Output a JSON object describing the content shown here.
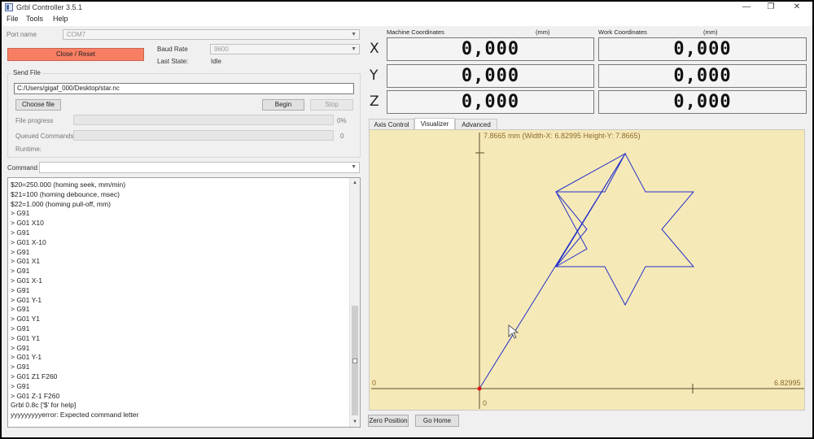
{
  "window": {
    "title": "Grbl Controller 3.5.1",
    "minimize": "—",
    "restore": "❐",
    "close": "✕"
  },
  "menu": [
    "File",
    "Tools",
    "Help"
  ],
  "connection": {
    "port_label": "Port name",
    "port_value": "COM7",
    "close_reset_label": "Close / Reset",
    "baud_label": "Baud Rate",
    "baud_value": "9600",
    "last_state_label": "Last State:",
    "last_state_value": "Idle"
  },
  "send_file": {
    "group_label": "Send File",
    "path": "C:/Users/gigaf_000/Desktop/star.nc",
    "choose_label": "Choose file",
    "begin_label": "Begin",
    "stop_label": "Stop",
    "progress_label": "File progress",
    "progress_value": "0%",
    "progress_fraction": 0,
    "queued_label": "Queued Commands",
    "queued_value": "0",
    "runtime_label": "Runtime:"
  },
  "command": {
    "label": "Command",
    "value": ""
  },
  "console_lines": [
    "$20=250.000 (homing seek, mm/min)",
    "$21=100 (homing debounce, msec)",
    "$22=1.000 (homing pull-off, mm)",
    "> G91",
    "> G01 X10",
    "> G91",
    "> G01 X-10",
    "> G91",
    "> G01 X1",
    "> G91",
    "> G01 X-1",
    "> G91",
    "> G01 Y-1",
    "> G91",
    "> G01 Y1",
    "> G91",
    "> G01 Y1",
    "> G91",
    "> G01 Y-1",
    "> G91",
    "> G01 Z1 F260",
    "> G91",
    "> G01 Z-1 F260",
    "Grbl 0.8c ['$' for help]",
    "yyyyyyyyyerror: Expected command letter"
  ],
  "coordinates": {
    "machine_label": "Machine Coordinates",
    "work_label": "Work Coordinates",
    "unit": "(mm)",
    "axes": [
      "X",
      "Y",
      "Z"
    ],
    "machine": [
      "0,000",
      "0,000",
      "0,000"
    ],
    "work": [
      "0,000",
      "0,000",
      "0,000"
    ]
  },
  "tabs": [
    "Axis Control",
    "Visualizer",
    "Advanced"
  ],
  "active_tab": "Visualizer",
  "visualizer": {
    "header": "7.8665 mm  (Width-X: 6.82995  Height-Y: 7.8665)",
    "x_min_label": "0",
    "x_max_label": "6.82995",
    "y_min_label": "0",
    "width_x": 6.82995,
    "height_y": 7.8665,
    "colors": {
      "background": "#f6e9b8",
      "path": "#2433c8",
      "axis": "#5a4a2a",
      "origin": "#e01010"
    }
  },
  "bottom_buttons": {
    "zero_position": "Zero Position",
    "go_home": "Go Home"
  }
}
